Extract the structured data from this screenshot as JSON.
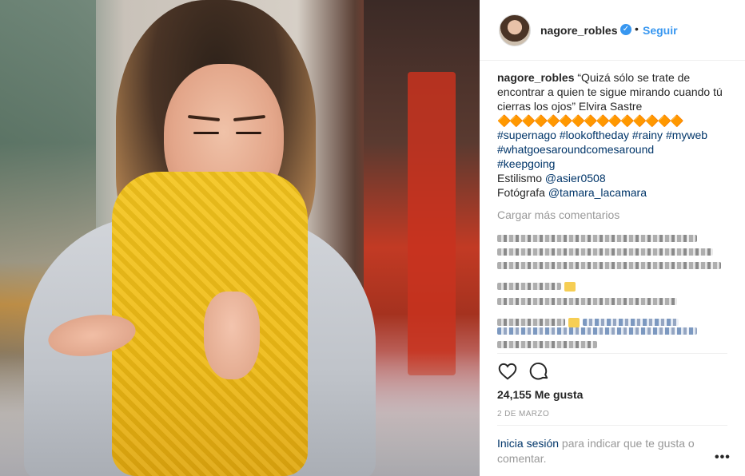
{
  "post": {
    "username": "nagore_robles",
    "verified_icon": "verified-badge-icon",
    "separator": "•",
    "follow_label": "Seguir"
  },
  "caption": {
    "username": "nagore_robles",
    "text": "“Quizá sólo se trate de encontrar a quien te sigue mirando cuando tú cierras los ojos” Elvira Sastre",
    "emoji_row": "🔶🔶🔶🔶🔶🔶🔶🔶🔶🔶🔶🔶🔶🔶🔶",
    "hashtags": [
      "#supernago",
      "#lookoftheday",
      "#rainy",
      "#myweb",
      "#whatgoesaroundcomesaround",
      "#keepgoing"
    ],
    "styling_label": "Estilismo",
    "styling_handle": "@asier0508",
    "photographer_label": "Fotógrafa",
    "photographer_handle": "@tamara_lacamara"
  },
  "load_more_label": "Cargar más comentarios",
  "actions": {
    "like_icon": "heart-icon",
    "comment_icon": "comment-icon"
  },
  "likes_text": "24,155 Me gusta",
  "date_text": "2 DE MARZO",
  "footer": {
    "login_link": "Inicia sesión",
    "login_rest": " para indicar que te gusta o comentar.",
    "more_label": "•••"
  },
  "colors": {
    "link_blue": "#3897f0",
    "hashtag_navy": "#003569",
    "muted_gray": "#999999",
    "text": "#262626"
  }
}
